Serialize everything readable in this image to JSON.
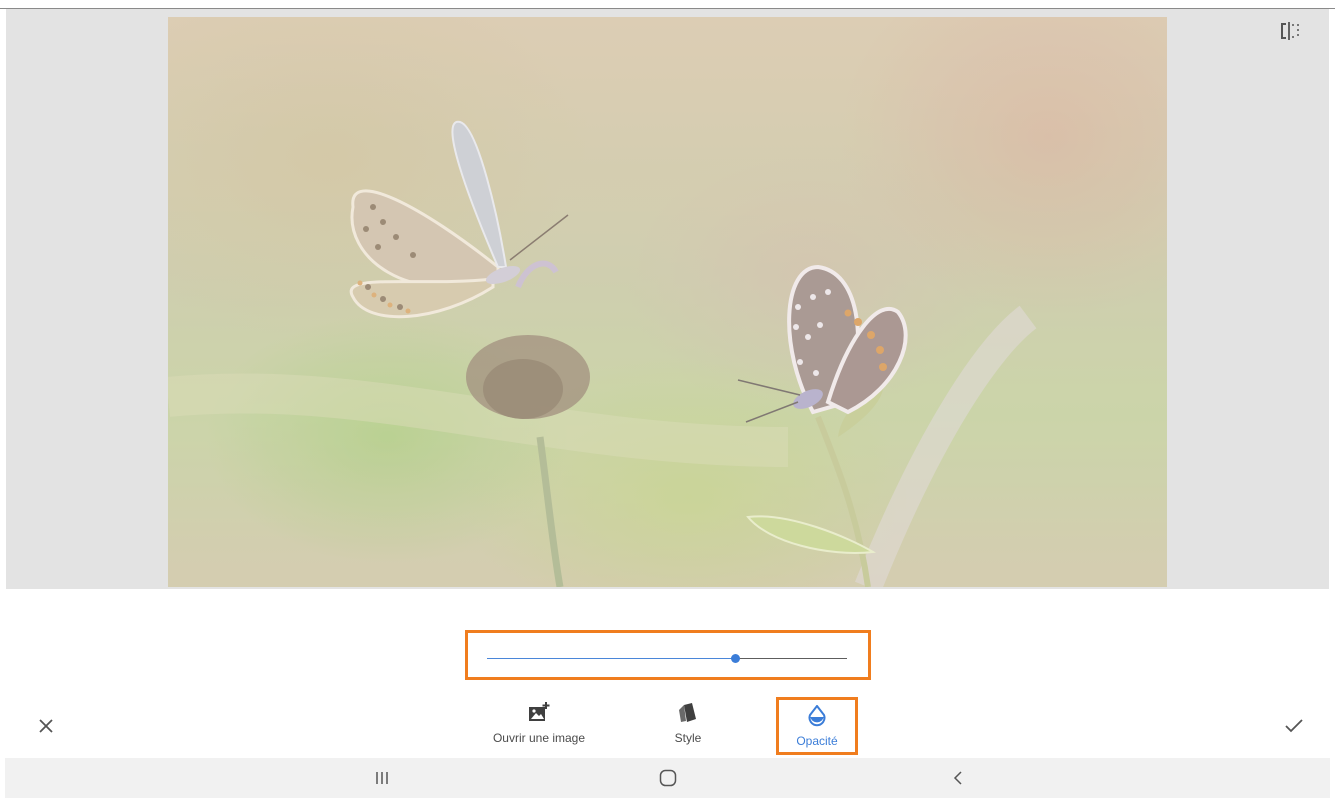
{
  "photo": {
    "alt_colors": {
      "butterfly_left": "#c9b9a6",
      "butterfly_right": "#a48e8a",
      "stem": "#9aa877"
    }
  },
  "compare": {
    "icon": "compare-icon"
  },
  "opacity_slider": {
    "value_fraction": 0.69,
    "accent": "#3b7dd8"
  },
  "highlight_color": "#f07d1e",
  "cancel": {
    "icon": "close-icon"
  },
  "apply": {
    "icon": "check-icon"
  },
  "tools": [
    {
      "label": "Ouvrir une image",
      "icon": "add-image-icon"
    },
    {
      "label": "Style",
      "icon": "style-cards-icon"
    },
    {
      "label": "Opacité",
      "icon": "opacity-drop-icon",
      "selected": true
    }
  ],
  "nav": {
    "recents_icon": "recents-icon",
    "home_icon": "home-icon",
    "back_icon": "back-icon"
  }
}
